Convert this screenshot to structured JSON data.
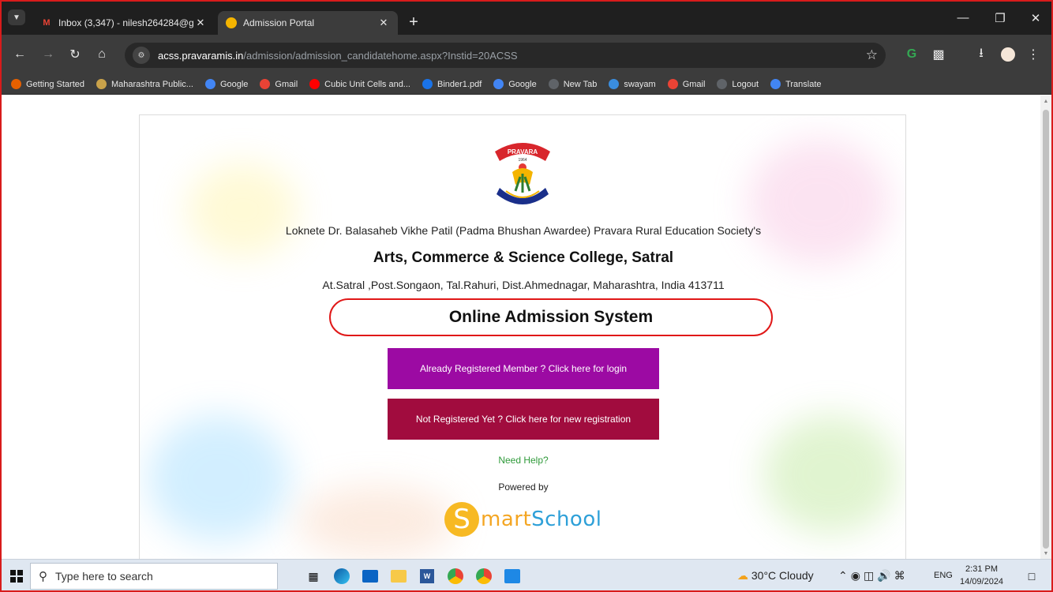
{
  "browser": {
    "tabs": [
      {
        "title": "Inbox (3,347) - nilesh264284@g",
        "active": false,
        "favicon": "gmail-icon"
      },
      {
        "title": "Admission Portal",
        "active": true,
        "favicon": "portal-icon"
      }
    ],
    "url": {
      "host": "acss.pravaramis.in",
      "path": "/admission/admission_candidatehome.aspx?Instid=20ACSS"
    },
    "bookmarks": [
      {
        "label": "Getting Started",
        "icon": "firefox-icon",
        "color": "#e66000"
      },
      {
        "label": "Maharashtra Public...",
        "icon": "emblem-icon",
        "color": "#c9a24a"
      },
      {
        "label": "Google",
        "icon": "google-icon",
        "color": "#4285f4"
      },
      {
        "label": "Gmail",
        "icon": "gmail-icon",
        "color": "#ea4335"
      },
      {
        "label": "Cubic Unit Cells and...",
        "icon": "youtube-icon",
        "color": "#ff0000"
      },
      {
        "label": "Binder1.pdf",
        "icon": "globe-icon",
        "color": "#1a73e8"
      },
      {
        "label": "Google",
        "icon": "google-icon",
        "color": "#4285f4"
      },
      {
        "label": "New Tab",
        "icon": "chrome-icon",
        "color": "#5f6368"
      },
      {
        "label": "swayam",
        "icon": "swayam-icon",
        "color": "#3a8dde"
      },
      {
        "label": "Gmail",
        "icon": "gmail-icon",
        "color": "#ea4335"
      },
      {
        "label": "Logout",
        "icon": "chrome-icon",
        "color": "#5f6368"
      },
      {
        "label": "Translate",
        "icon": "translate-icon",
        "color": "#4285f4"
      }
    ]
  },
  "page": {
    "logo_text": "PRAVARA",
    "logo_year": "1964",
    "society": "Loknete Dr. Balasaheb Vikhe Patil (Padma Bhushan Awardee) Pravara Rural Education Society's",
    "college": "Arts, Commerce & Science College, Satral",
    "address": "At.Satral ,Post.Songaon, Tal.Rahuri, Dist.Ahmednagar, Maharashtra, India 413711",
    "system_title": "Online Admission System",
    "login_button": "Already Registered Member ? Click here for login",
    "register_button": "Not Registered Yet ? Click here for new registration",
    "help_link": "Need Help?",
    "powered_by": "Powered by",
    "brand": {
      "s_letter": "S",
      "mart": "mart",
      "school": "School"
    }
  },
  "colors": {
    "login_button": "#9c0aa3",
    "register_button": "#a10c3e",
    "help_link": "#2f9a3a",
    "highlight_ring": "#e01818"
  },
  "taskbar": {
    "search_placeholder": "Type here to search",
    "weather": "30°C  Cloudy",
    "language": "ENG",
    "time": "2:31 PM",
    "date": "14/09/2024"
  }
}
